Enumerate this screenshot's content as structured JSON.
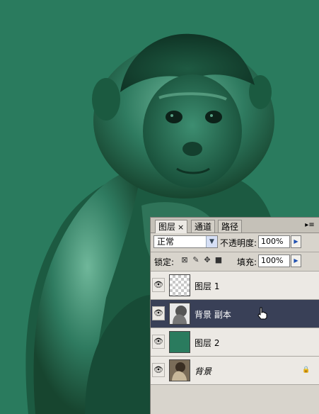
{
  "panel": {
    "tabs": [
      {
        "label": "图层",
        "close": "×",
        "active": true
      },
      {
        "label": "通道",
        "active": false
      },
      {
        "label": "路径",
        "active": false
      }
    ],
    "menu_icon": "panel-menu-icon",
    "blend_mode": "正常",
    "opacity_label": "不透明度:",
    "opacity_value": "100%",
    "lock_label": "锁定:",
    "fill_label": "填充:",
    "fill_value": "100%",
    "layers": [
      {
        "name": "图层 1",
        "thumb": "transparent",
        "visible": true,
        "selected": false,
        "locked": false
      },
      {
        "name": "背景 副本",
        "thumb": "monkey-mono",
        "visible": true,
        "selected": true,
        "locked": false
      },
      {
        "name": "图层 2",
        "thumb": "green-fill",
        "visible": true,
        "selected": false,
        "locked": false
      },
      {
        "name": "背景",
        "thumb": "monkey-photo",
        "visible": true,
        "selected": false,
        "locked": true
      }
    ]
  },
  "colors": {
    "canvas_background": "#2a7b5e",
    "selected_layer": "#394057",
    "panel_background": "#ece9e4"
  }
}
